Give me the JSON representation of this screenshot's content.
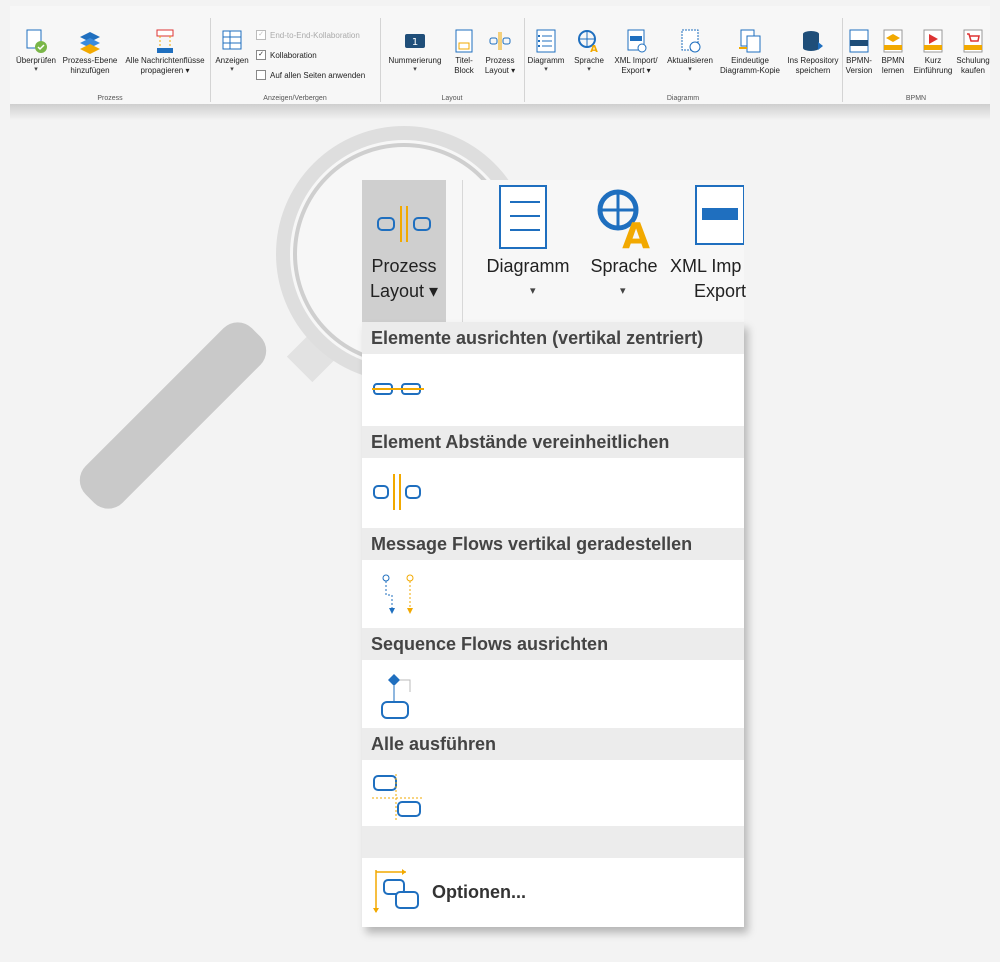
{
  "ribbon": {
    "groups": {
      "prozess": "Prozess",
      "anzeigen": "Anzeigen/Verbergen",
      "layout": "Layout",
      "diagramm": "Diagramm",
      "bpmn": "BPMN"
    },
    "buttons": {
      "ueberpruefen": "Überprüfen",
      "prozess_ebene_1": "Prozess-Ebene",
      "prozess_ebene_2": "hinzufügen",
      "alle_1": "Alle Nachrichtenflüsse",
      "alle_2": "propagieren ▾",
      "anzeigen": "Anzeigen",
      "nummerierung": "Nummerierung",
      "titel_1": "Titel-",
      "titel_2": "Block",
      "prozess_1": "Prozess",
      "prozess_2": "Layout ▾",
      "diagramm": "Diagramm",
      "sprache": "Sprache",
      "xml_1": "XML Import/",
      "xml_2": "Export ▾",
      "aktualisieren": "Aktualisieren",
      "eindeutige_1": "Eindeutige",
      "eindeutige_2": "Diagramm-Kopie",
      "repo_1": "Ins Repository",
      "repo_2": "speichern",
      "bpmn_version_1": "BPMN-",
      "bpmn_version_2": "Version",
      "bpmn_lernen_1": "BPMN",
      "bpmn_lernen_2": "lernen",
      "kurz_1": "Kurz",
      "kurz_2": "Einführung",
      "schulung_1": "Schulung",
      "schulung_2": "kaufen"
    },
    "checkboxes": {
      "e2e": "End-to-End-Kollaboration",
      "kollaboration": "Kollaboration",
      "alle_seiten": "Auf allen Seiten anwenden"
    }
  },
  "zoom": {
    "prozess_1": "Prozess",
    "prozess_2": "Layout ▾",
    "diagramm": "Diagramm",
    "sprache": "Sprache",
    "xml_1": "XML Imp",
    "xml_2": "Export"
  },
  "menu": {
    "sections": [
      "Elemente ausrichten (vertikal zentriert)",
      "Element Abstände vereinheitlichen",
      "Message Flows vertikal geradestellen",
      "Sequence Flows ausrichten",
      "Alle ausführen"
    ],
    "options": "Optionen..."
  },
  "colors": {
    "accent_orange": "#f2a900",
    "accent_blue": "#1f6fbf",
    "panel_header": "#ececec"
  }
}
